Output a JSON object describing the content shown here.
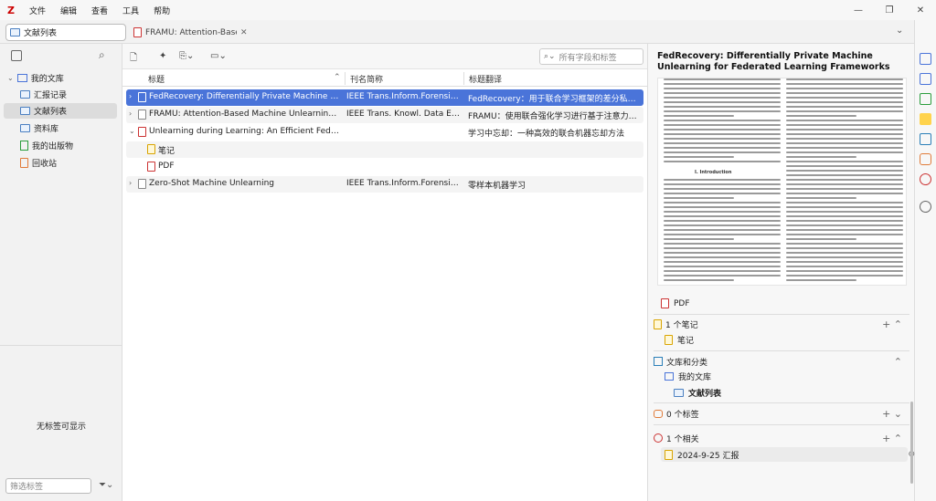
{
  "menu": {
    "logo": "Z",
    "items": [
      "文件",
      "编辑",
      "查看",
      "工具",
      "帮助"
    ]
  },
  "window_controls": {
    "minimize": "—",
    "restore": "❐",
    "close": "✕"
  },
  "tabs": [
    {
      "label": "文献列表"
    },
    {
      "label": "FRAMU: Attention-Base"
    }
  ],
  "collections": {
    "root": "我的文库",
    "items": [
      "汇报记录",
      "文献列表",
      "资料库",
      "我的出版物",
      "回收站"
    ],
    "selected": "文献列表"
  },
  "tags": {
    "empty_text": "无标签可显示",
    "filter_placeholder": "筛选标签"
  },
  "toolbar": {
    "search_placeholder": "所有字段和标签"
  },
  "columns": {
    "title": "标题",
    "publication": "刊名简称",
    "translation": "标题翻译"
  },
  "rows": [
    {
      "title": "FedRecovery: Differentially Private Machine Unl...",
      "publication": "IEEE Trans.Inform.Forensic ...",
      "translation": "FedRecovery：用于联合学习框架的差分私有...",
      "selected": true
    },
    {
      "title": "FRAMU: Attention-Based Machine Unlearning U...",
      "publication": "IEEE Trans. Knowl. Data Eng.",
      "translation": "FRAMU：使用联合强化学习进行基于注意力的..."
    },
    {
      "title": "Unlearning during Learning: An Efficient Federa...",
      "publication": "",
      "translation": "学习中忘却：一种高效的联合机器忘却方法",
      "expanded": true
    },
    {
      "title": "笔记",
      "child": true,
      "kind": "note"
    },
    {
      "title": "PDF",
      "child": true,
      "kind": "pdf"
    },
    {
      "title": "Zero-Shot Machine Unlearning",
      "publication": "IEEE Trans.Inform.Forensic ...",
      "translation": "零样本机器学习"
    }
  ],
  "item_pane": {
    "title": "FedRecovery: Differentially Private Machine Unlearning for Federated Learning Frameworks",
    "pdf_section_heading": "I. Introduction",
    "attachment_label": "PDF",
    "notes_header": "1 个笔记",
    "note_item": "笔记",
    "libraries_header": "文库和分类",
    "library_root": "我的文库",
    "library_child": "文献列表",
    "tags_header": "0 个标签",
    "related_header": "1 个相关",
    "related_item": "2024-9-25 汇报"
  }
}
